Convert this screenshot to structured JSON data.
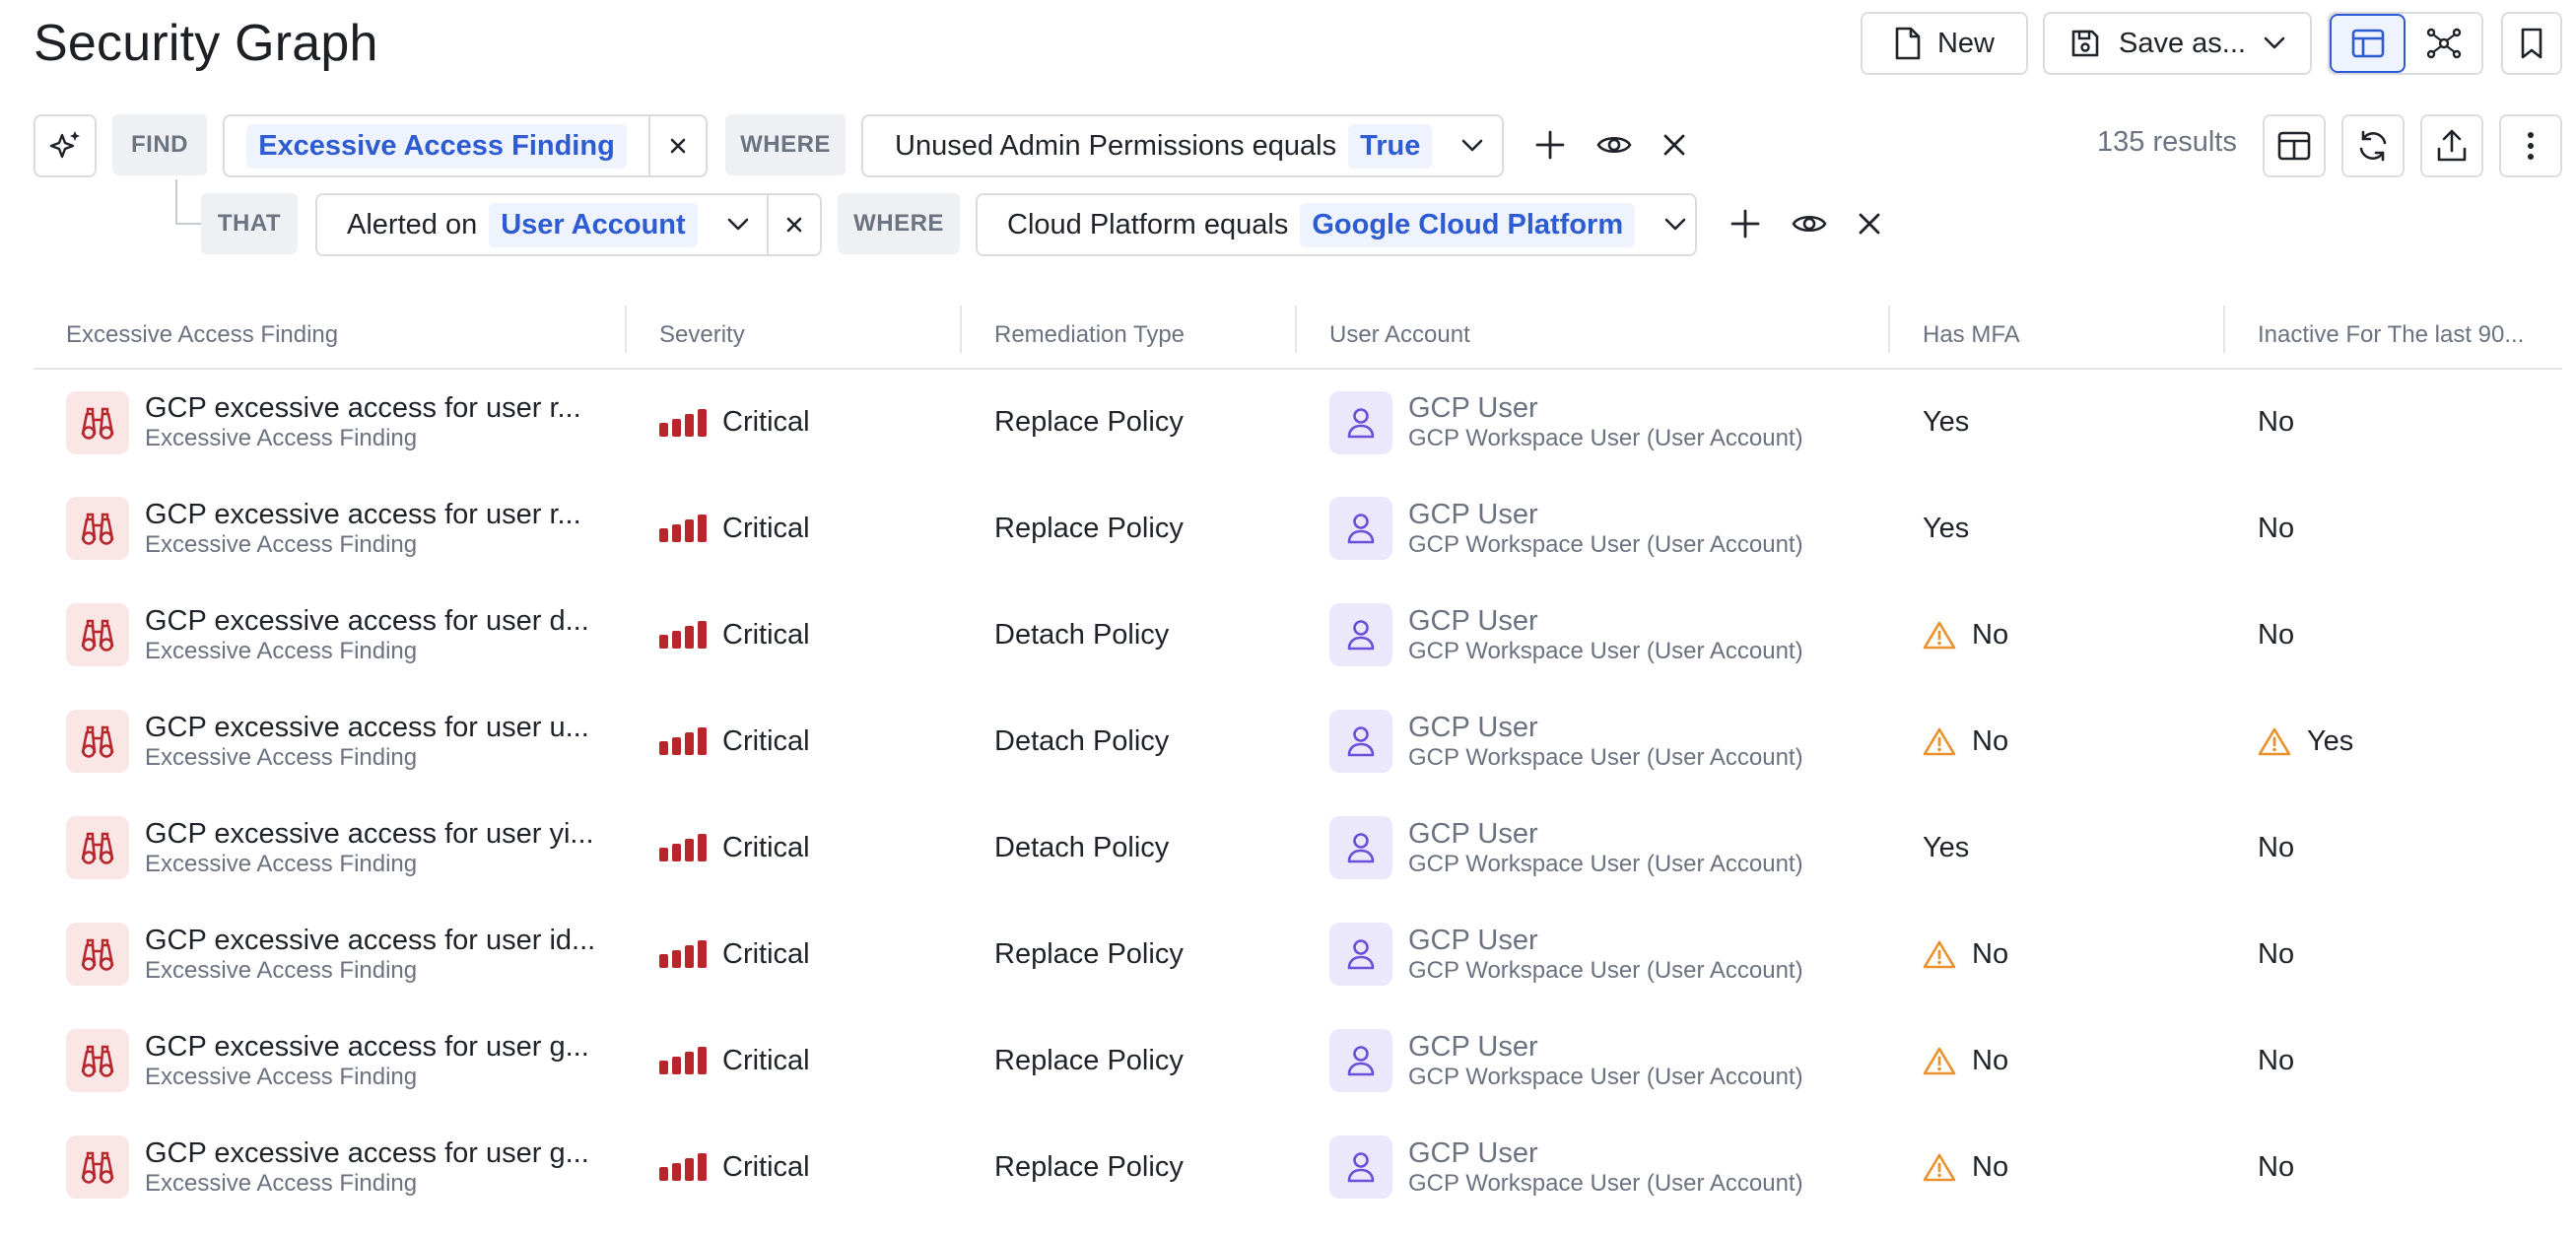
{
  "header": {
    "title": "Security Graph",
    "new_label": "New",
    "save_label": "Save as..."
  },
  "query": {
    "find_label": "FIND",
    "find_entity": "Excessive Access Finding",
    "where_label": "WHERE",
    "condition1_text": "Unused Admin Permissions equals",
    "condition1_value": "True",
    "that_label": "THAT",
    "relation_text": "Alerted on",
    "relation_entity": "User Account",
    "where2_label": "WHERE",
    "condition2_text": "Cloud Platform equals",
    "condition2_value": "Google Cloud Platform",
    "results": "135 results"
  },
  "table": {
    "columns": [
      "Excessive Access Finding",
      "Severity",
      "Remediation Type",
      "User Account",
      "Has MFA",
      "Inactive For The last 90..."
    ],
    "rows": [
      {
        "title": "GCP excessive access for user r...",
        "type": "Excessive Access Finding",
        "severity": "Critical",
        "remediation": "Replace Policy",
        "user": "GCP User",
        "user_type": "GCP Workspace User (User Account)",
        "mfa": "Yes",
        "mfa_warn": false,
        "inactive": "No",
        "inactive_warn": false
      },
      {
        "title": "GCP excessive access for user r...",
        "type": "Excessive Access Finding",
        "severity": "Critical",
        "remediation": "Replace Policy",
        "user": "GCP User",
        "user_type": "GCP Workspace User (User Account)",
        "mfa": "Yes",
        "mfa_warn": false,
        "inactive": "No",
        "inactive_warn": false
      },
      {
        "title": "GCP excessive access for user d...",
        "type": "Excessive Access Finding",
        "severity": "Critical",
        "remediation": "Detach Policy",
        "user": "GCP User",
        "user_type": "GCP Workspace User (User Account)",
        "mfa": "No",
        "mfa_warn": true,
        "inactive": "No",
        "inactive_warn": false
      },
      {
        "title": "GCP excessive access for user u...",
        "type": "Excessive Access Finding",
        "severity": "Critical",
        "remediation": "Detach Policy",
        "user": "GCP User",
        "user_type": "GCP Workspace User (User Account)",
        "mfa": "No",
        "mfa_warn": true,
        "inactive": "Yes",
        "inactive_warn": true
      },
      {
        "title": "GCP excessive access for user yi...",
        "type": "Excessive Access Finding",
        "severity": "Critical",
        "remediation": "Detach Policy",
        "user": "GCP User",
        "user_type": "GCP Workspace User (User Account)",
        "mfa": "Yes",
        "mfa_warn": false,
        "inactive": "No",
        "inactive_warn": false
      },
      {
        "title": "GCP excessive access for user id...",
        "type": "Excessive Access Finding",
        "severity": "Critical",
        "remediation": "Replace Policy",
        "user": "GCP User",
        "user_type": "GCP Workspace User (User Account)",
        "mfa": "No",
        "mfa_warn": true,
        "inactive": "No",
        "inactive_warn": false
      },
      {
        "title": "GCP excessive access for user g...",
        "type": "Excessive Access Finding",
        "severity": "Critical",
        "remediation": "Replace Policy",
        "user": "GCP User",
        "user_type": "GCP Workspace User (User Account)",
        "mfa": "No",
        "mfa_warn": true,
        "inactive": "No",
        "inactive_warn": false
      },
      {
        "title": "GCP excessive access for user g...",
        "type": "Excessive Access Finding",
        "severity": "Critical",
        "remediation": "Replace Policy",
        "user": "GCP User",
        "user_type": "GCP Workspace User (User Account)",
        "mfa": "No",
        "mfa_warn": true,
        "inactive": "No",
        "inactive_warn": false
      }
    ]
  },
  "colors": {
    "accent": "#2d5bd1",
    "critical": "#b8262b",
    "warning": "#e8912d",
    "user_icon": "#6a4fd8"
  }
}
